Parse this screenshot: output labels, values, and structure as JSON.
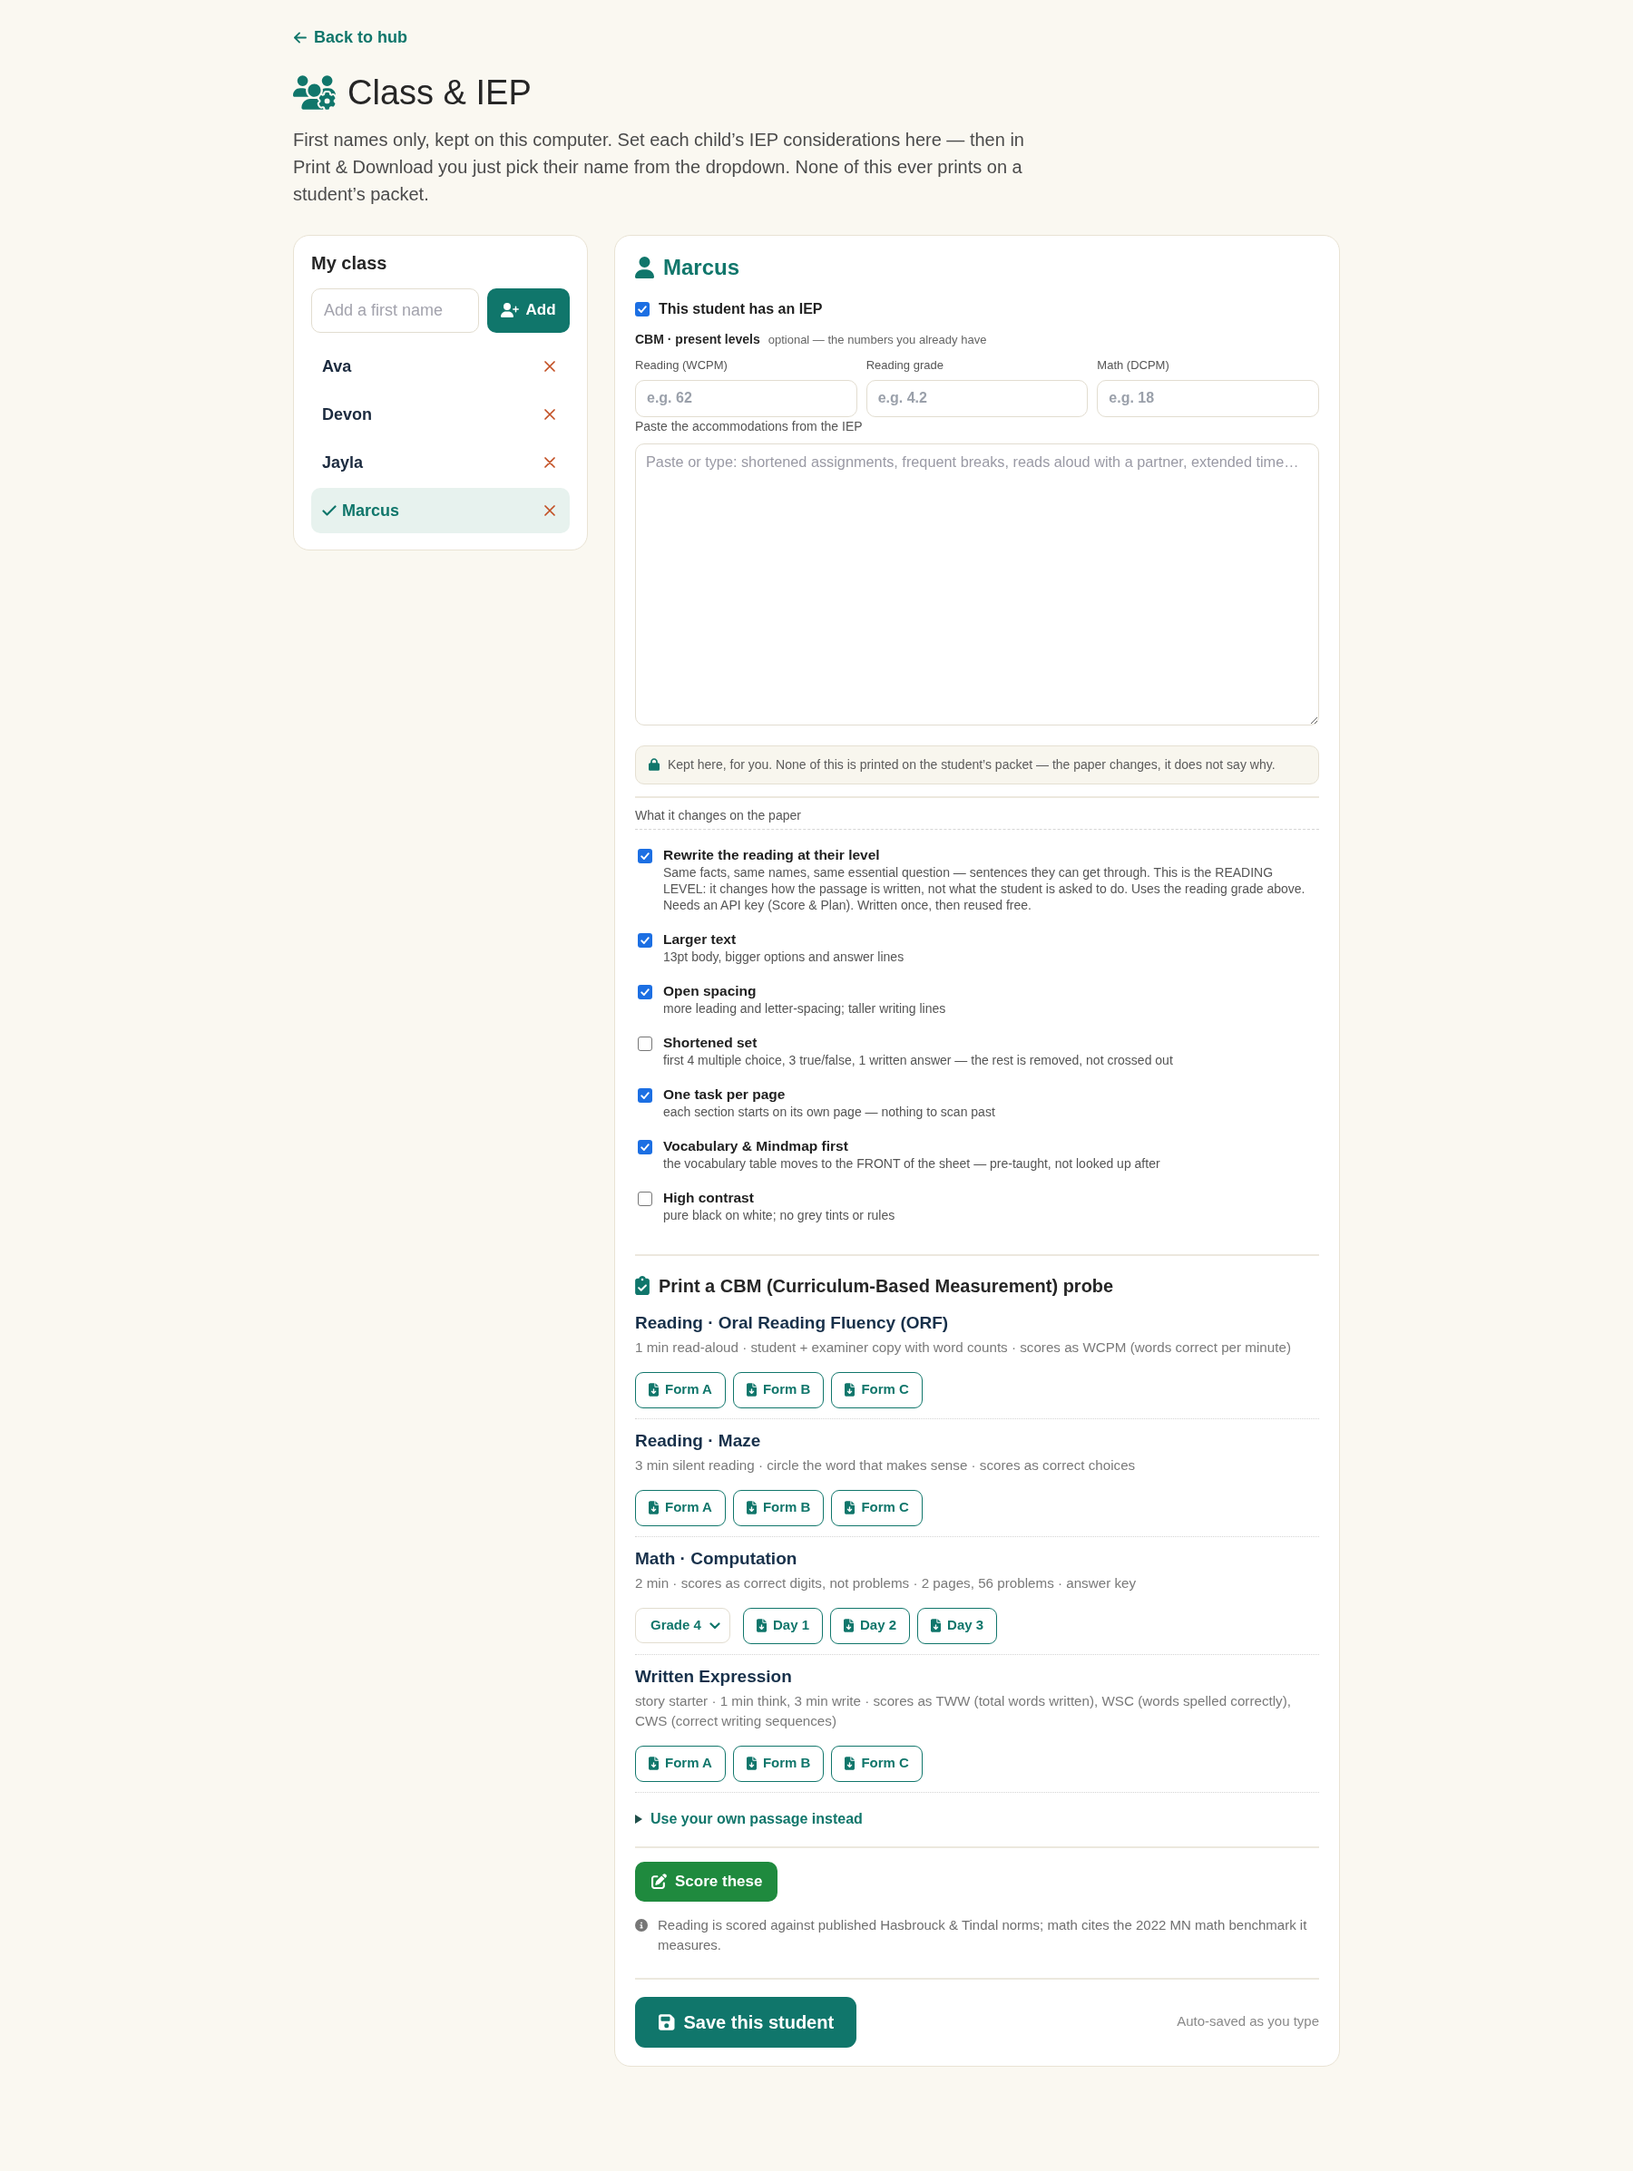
{
  "back_link": {
    "label": "Back to hub"
  },
  "header": {
    "title": "Class & IEP",
    "intro": "First names only, kept on this computer. Set each child’s IEP considerations here — then in Print & Download you just pick their name from the dropdown. None of this ever prints on a student’s packet."
  },
  "class_panel": {
    "title": "My class",
    "name_field": {
      "placeholder": "Add a first name"
    },
    "add_button": "Add",
    "students": [
      {
        "name": "Ava",
        "selected": false
      },
      {
        "name": "Devon",
        "selected": false
      },
      {
        "name": "Jayla",
        "selected": false
      },
      {
        "name": "Marcus",
        "selected": true
      }
    ]
  },
  "student_panel": {
    "name": "Marcus",
    "iep": {
      "label": "This student has an IEP",
      "checked": true
    },
    "present_levels": {
      "title": "CBM · present levels",
      "note": "optional — the numbers you already have",
      "fields": [
        {
          "label": "Reading (WCPM)",
          "placeholder": "e.g. 62"
        },
        {
          "label": "Reading grade",
          "placeholder": "e.g. 4.2"
        },
        {
          "label": "Math (DCPM)",
          "placeholder": "e.g. 18"
        }
      ]
    },
    "accommodations": {
      "label": "Paste the accommodations from the IEP",
      "placeholder": "Paste or type: shortened assignments, frequent breaks, reads aloud with a partner, extended time…"
    },
    "privacy_note": "Kept here, for you. None of this is printed on the student’s packet — the paper changes, it does not say why.",
    "changes": {
      "title": "What it changes on the paper",
      "options": [
        {
          "title": "Rewrite the reading at their level",
          "description": "Same facts, same names, same essential question — sentences they can get through. This is the READING LEVEL: it changes how the passage is written, not what the student is asked to do. Uses the reading grade above. Needs an API key (Score & Plan). Written once, then reused free.",
          "checked": true
        },
        {
          "title": "Larger text",
          "description": "13pt body, bigger options and answer lines",
          "checked": true
        },
        {
          "title": "Open spacing",
          "description": "more leading and letter-spacing; taller writing lines",
          "checked": true
        },
        {
          "title": "Shortened set",
          "description": "first 4 multiple choice, 3 true/false, 1 written answer — the rest is removed, not crossed out",
          "checked": false
        },
        {
          "title": "One task per page",
          "description": "each section starts on its own page — nothing to scan past",
          "checked": true
        },
        {
          "title": "Vocabulary & Mindmap first",
          "description": "the vocabulary table moves to the FRONT of the sheet — pre-taught, not looked up after",
          "checked": true
        },
        {
          "title": "High contrast",
          "description": "pure black on white; no grey tints or rules",
          "checked": false
        }
      ]
    },
    "probes": {
      "title": "Print a CBM (Curriculum-Based Measurement) probe",
      "sections": [
        {
          "kind": "forms",
          "title": "Reading · Oral Reading Fluency (ORF)",
          "description": "1 min read-aloud · student + examiner copy with word counts · scores as WCPM (words correct per minute)",
          "buttons": [
            "Form A",
            "Form B",
            "Form C"
          ]
        },
        {
          "kind": "forms",
          "title": "Reading · Maze",
          "description": "3 min silent reading · circle the word that makes sense · scores as correct choices",
          "buttons": [
            "Form A",
            "Form B",
            "Form C"
          ]
        },
        {
          "kind": "grade_days",
          "title": "Math · Computation",
          "description": "2 min · scores as correct digits, not problems · 2 pages, 56 problems · answer key",
          "select": "Grade 4",
          "buttons": [
            "Day 1",
            "Day 2",
            "Day 3"
          ]
        },
        {
          "kind": "forms",
          "title": "Written Expression",
          "description": "story starter · 1 min think, 3 min write · scores as TWW (total words written), WSC (words spelled correctly), CWS (correct writing sequences)",
          "buttons": [
            "Form A",
            "Form B",
            "Form C"
          ]
        }
      ]
    },
    "own_passage": {
      "label": "Use your own passage instead",
      "expanded": false
    },
    "score_button": "Score these",
    "info_note": "Reading is scored against published Hasbrouck & Tindal norms; math cites the 2022 MN math benchmark it measures.",
    "save_button": "Save this student",
    "autosave_note": "Auto-saved as you type"
  }
}
